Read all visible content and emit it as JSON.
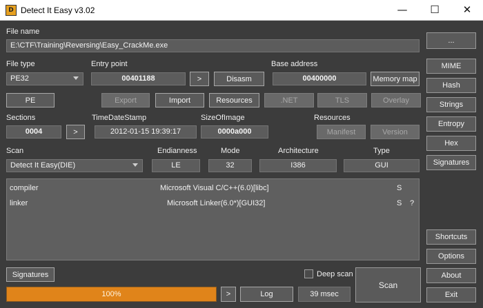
{
  "window": {
    "title": "Detect It Easy v3.02",
    "logo_text": "D",
    "minimize": "—",
    "maximize": "☐",
    "close": "✕"
  },
  "file_name": {
    "label": "File name",
    "value": "E:\\CTF\\Training\\Reversing\\Easy_CrackMe.exe",
    "browse": "..."
  },
  "file_type": {
    "label": "File type",
    "value": "PE32"
  },
  "entry_point": {
    "label": "Entry point",
    "value": "00401188",
    "go": ">",
    "disasm": "Disasm"
  },
  "base_address": {
    "label": "Base address",
    "value": "00400000",
    "memory_map": "Memory map"
  },
  "pe_buttons": {
    "pe": "PE",
    "export": "Export",
    "import": "Import",
    "resources": "Resources",
    "net": ".NET",
    "tls": "TLS",
    "overlay": "Overlay"
  },
  "sections": {
    "label": "Sections",
    "value": "0004",
    "go": ">"
  },
  "timestamp": {
    "label": "TimeDateStamp",
    "value": "2012-01-15 19:39:17"
  },
  "size_of_image": {
    "label": "SizeOfImage",
    "value": "0000a000"
  },
  "resources": {
    "label": "Resources",
    "manifest": "Manifest",
    "version": "Version"
  },
  "scan": {
    "label": "Scan",
    "engine": "Detect It Easy(DIE)"
  },
  "endianness": {
    "label": "Endianness",
    "value": "LE"
  },
  "mode": {
    "label": "Mode",
    "value": "32"
  },
  "architecture": {
    "label": "Architecture",
    "value": "I386"
  },
  "type": {
    "label": "Type",
    "value": "GUI"
  },
  "results": [
    {
      "kind": "compiler",
      "name": "Microsoft Visual C/C++(6.0)[libc]",
      "flag": "S",
      "extra": ""
    },
    {
      "kind": "linker",
      "name": "Microsoft Linker(6.0*)[GUI32]",
      "flag": "S",
      "extra": "?"
    }
  ],
  "bottom": {
    "signatures": "Signatures",
    "deep_scan": "Deep scan",
    "progress_text": "100%",
    "progress": 1.0,
    "go": ">",
    "log": "Log",
    "time": "39 msec",
    "scan": "Scan"
  },
  "sidebar": {
    "mime": "MIME",
    "hash": "Hash",
    "strings": "Strings",
    "entropy": "Entropy",
    "hex": "Hex",
    "signatures": "Signatures",
    "shortcuts": "Shortcuts",
    "options": "Options",
    "about": "About",
    "exit": "Exit"
  }
}
